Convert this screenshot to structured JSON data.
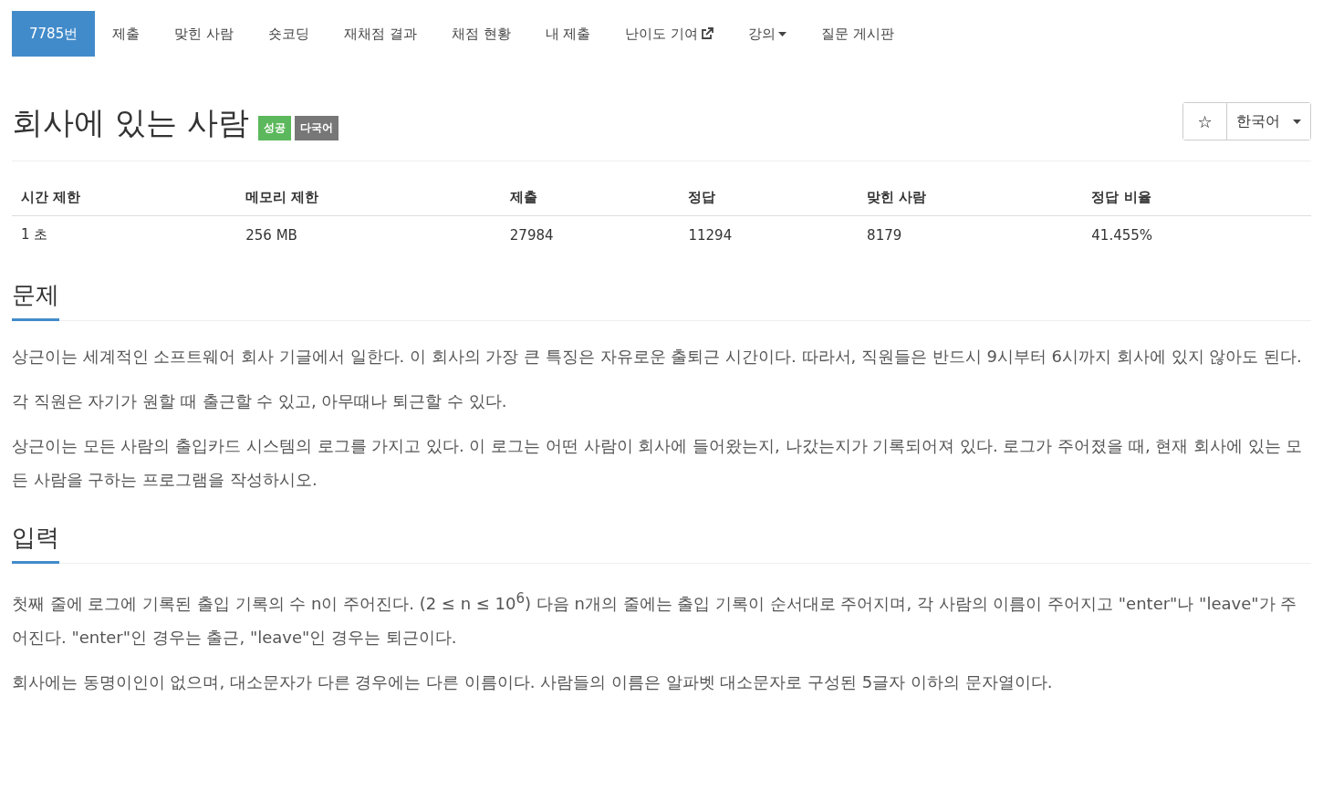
{
  "nav": [
    {
      "label": "7785번",
      "kind": "link",
      "selected": true
    },
    {
      "label": "제출",
      "kind": "link",
      "selected": false
    },
    {
      "label": "맞힌 사람",
      "kind": "link",
      "selected": false
    },
    {
      "label": "숏코딩",
      "kind": "link",
      "selected": false
    },
    {
      "label": "재채점 결과",
      "kind": "link",
      "selected": false
    },
    {
      "label": "채점 현황",
      "kind": "link",
      "selected": false
    },
    {
      "label": "내 제출",
      "kind": "link",
      "selected": false
    },
    {
      "label": "난이도 기여",
      "kind": "external",
      "selected": false
    },
    {
      "label": "강의",
      "kind": "dropdown",
      "selected": false
    },
    {
      "label": "질문 게시판",
      "kind": "link",
      "selected": false
    }
  ],
  "title": "회사에 있는 사람",
  "badges": [
    {
      "label": "성공",
      "color": "#5cb85c"
    },
    {
      "label": "다국어",
      "color": "#777777"
    }
  ],
  "language": {
    "star": "☆",
    "value": "한국어"
  },
  "table": {
    "columns": [
      "시간 제한",
      "메모리 제한",
      "제출",
      "정답",
      "맞힌 사람",
      "정답 비율"
    ],
    "rows": [
      [
        "1 초",
        "256 MB",
        "27984",
        "11294",
        "8179",
        "41.455%"
      ]
    ]
  },
  "sections": [
    {
      "title": "문제",
      "paragraphs": [
        "상근이는 세계적인 소프트웨어 회사 기글에서 일한다. 이 회사의 가장 큰 특징은 자유로운 출퇴근 시간이다. 따라서, 직원들은 반드시 9시부터 6시까지 회사에 있지 않아도 된다.",
        "각 직원은 자기가 원할 때 출근할 수 있고, 아무때나 퇴근할 수 있다.",
        "상근이는 모든 사람의 출입카드 시스템의 로그를 가지고 있다. 이 로그는 어떤 사람이 회사에 들어왔는지, 나갔는지가 기록되어져 있다. 로그가 주어졌을 때, 현재 회사에 있는 모든 사람을 구하는 프로그램을 작성하시오."
      ]
    },
    {
      "title": "입력",
      "paragraphs": [
        "첫째 줄에 로그에 기록된 출입 기록의 수 n이 주어진다. (2 ≤ n ≤ 10$^{6}$) 다음 n개의 줄에는 출입 기록이 순서대로 주어지며, 각 사람의 이름이 주어지고 \"enter\"나 \"leave\"가 주어진다. \"enter\"인 경우는 출근, \"leave\"인 경우는 퇴근이다.",
        "회사에는 동명이인이 없으며, 대소문자가 다른 경우에는 다른 이름이다. 사람들의 이름은 알파벳 대소문자로 구성된 5글자 이하의 문자열이다."
      ]
    }
  ]
}
